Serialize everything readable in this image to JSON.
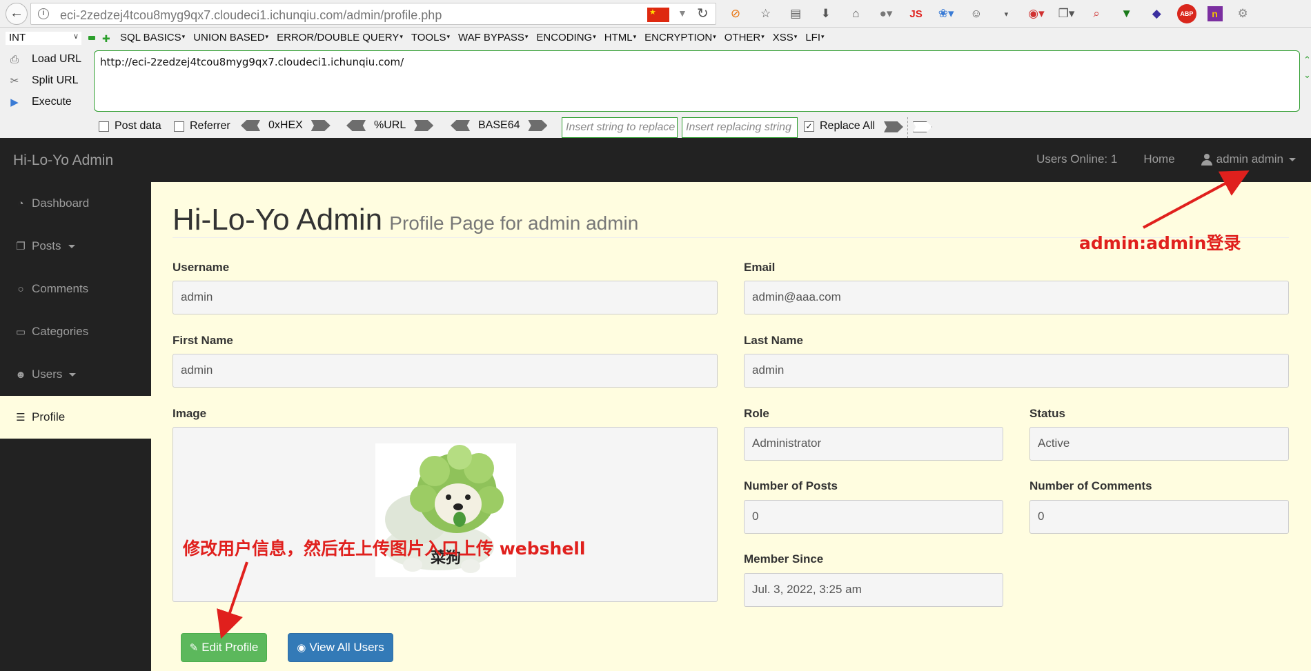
{
  "browser": {
    "url_text": "eci-2zedzej4tcou8myg9qx7.cloudeci1.ichunqiu.com/admin/profile.php",
    "icons": [
      "block-icon",
      "star-icon",
      "reader-icon",
      "download-icon",
      "home-icon",
      "globe-icon",
      "js-icon",
      "extension-icon",
      "palette-icon",
      "menu-dropdown-icon",
      "addon-icon",
      "screenshot-icon",
      "search-addon-icon",
      "shield-icon",
      "cube-icon",
      "abp-icon",
      "n-icon",
      "settings-icon"
    ],
    "js_label": "JS",
    "abp_label": "ABP"
  },
  "hackbar": {
    "select_value": "INT",
    "menus": [
      "SQL BASICS",
      "UNION BASED",
      "ERROR/DOUBLE QUERY",
      "TOOLS",
      "WAF BYPASS",
      "ENCODING",
      "HTML",
      "ENCRYPTION",
      "OTHER",
      "XSS",
      "LFI"
    ],
    "load_url": "Load URL",
    "split_url": "Split URL",
    "execute": "Execute",
    "url_value": "http://eci-2zedzej4tcou8myg9qx7.cloudeci1.ichunqiu.com/",
    "post_data": "Post data",
    "referrer": "Referrer",
    "hex": "0xHEX",
    "urlenc": "%URL",
    "base64": "BASE64",
    "replace_placeholder": "Insert string to replace",
    "replacing_placeholder": "Insert replacing string",
    "replace_all": "Replace All",
    "replace_all_checked": true
  },
  "navbar": {
    "brand": "Hi-Lo-Yo Admin",
    "users_online": "Users Online: 1",
    "home": "Home",
    "user": "admin admin"
  },
  "sidebar": {
    "items": [
      {
        "label": "Dashboard",
        "icon": "dashboard-icon"
      },
      {
        "label": "Posts",
        "icon": "posts-icon"
      },
      {
        "label": "Comments",
        "icon": "comment-icon"
      },
      {
        "label": "Categories",
        "icon": "folder-icon"
      },
      {
        "label": "Users",
        "icon": "users-icon"
      },
      {
        "label": "Profile",
        "icon": "file-icon"
      }
    ],
    "active": "Profile"
  },
  "page": {
    "title": "Hi-Lo-Yo Admin",
    "subtitle": "Profile Page for admin admin"
  },
  "profile": {
    "username_label": "Username",
    "username": "admin",
    "email_label": "Email",
    "email": "admin@aaa.com",
    "firstname_label": "First Name",
    "firstname": "admin",
    "lastname_label": "Last Name",
    "lastname": "admin",
    "image_label": "Image",
    "image_caption": "菜狗",
    "role_label": "Role",
    "role": "Administrator",
    "status_label": "Status",
    "status": "Active",
    "posts_label": "Number of Posts",
    "posts": "0",
    "comments_label": "Number of Comments",
    "comments": "0",
    "since_label": "Member Since",
    "since": "Jul. 3, 2022, 3:25 am"
  },
  "buttons": {
    "edit_profile": "Edit Profile",
    "view_users": "View All Users"
  },
  "annotations": {
    "login_note": "admin:admin登录",
    "upload_note": "修改用户信息，然后在上传图片入口上传 webshell",
    "color": "#e0201d"
  },
  "colors": {
    "navbar_bg": "#222222",
    "content_bg": "#fffde0",
    "edit_btn": "#5cb85c",
    "view_btn": "#337ab7"
  }
}
